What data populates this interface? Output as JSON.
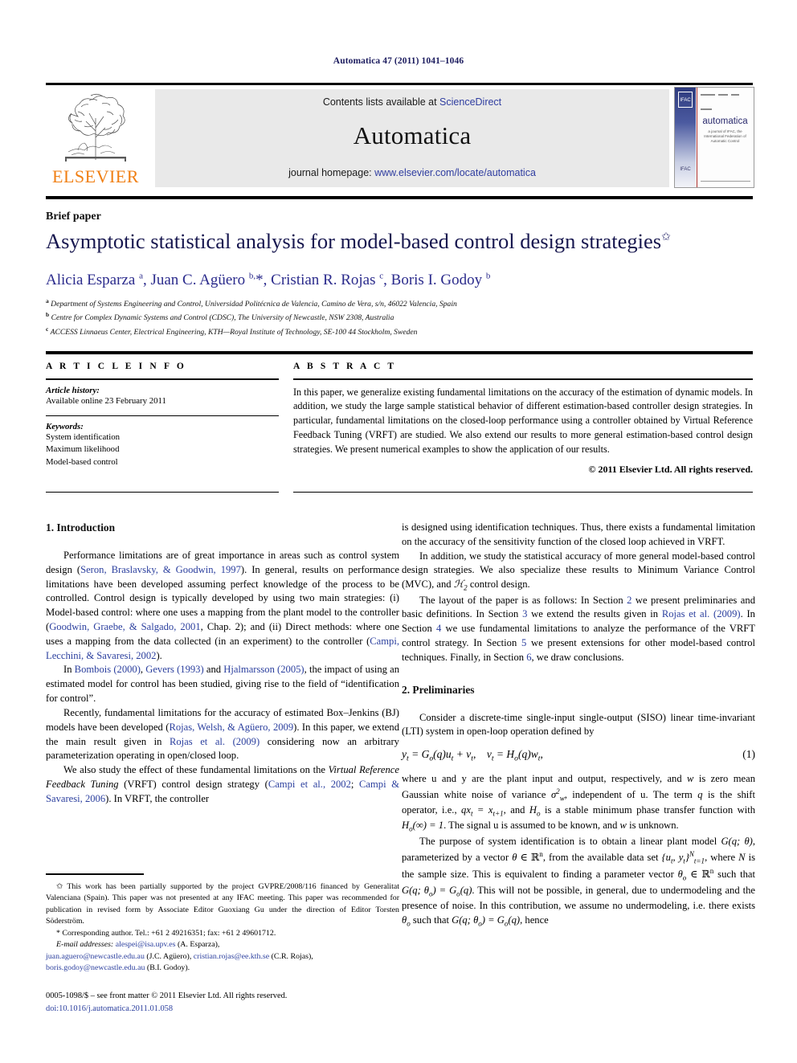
{
  "running_head": "Automatica 47 (2011) 1041–1046",
  "masthead": {
    "publisher_name": "ELSEVIER",
    "contents_prefix": "Contents lists available at ",
    "contents_link": "ScienceDirect",
    "journal_title": "Automatica",
    "homepage_prefix": "journal homepage: ",
    "homepage_link": "www.elsevier.com/locate/automatica",
    "cover": {
      "name": "automatica",
      "subtitle": "a journal of IFAC, the International Federation of Automatic Control",
      "badge": "IFAC"
    }
  },
  "article": {
    "type_label": "Brief paper",
    "title": "Asymptotic statistical analysis for model-based control design strategies",
    "title_footnote_marker": "✩",
    "authors_html": "Alicia Esparza <sup>a</sup>, Juan C. Agüero <sup>b,</sup>*, Cristian R. Rojas <sup>c</sup>, Boris I. Godoy <sup>b</sup>",
    "affiliations": [
      {
        "marker": "a",
        "text": "Department of Systems Engineering and Control, Universidad Politécnica de Valencia, Camino de Vera, s/n, 46022 Valencia, Spain"
      },
      {
        "marker": "b",
        "text": "Centre for Complex Dynamic Systems and Control (CDSC), The University of Newcastle, NSW 2308, Australia"
      },
      {
        "marker": "c",
        "text": "ACCESS Linnaeus Center, Electrical Engineering, KTH—Royal Institute of Technology, SE-100 44 Stockholm, Sweden"
      }
    ]
  },
  "article_info": {
    "heading": "A R T I C L E    I N F O",
    "history_label": "Article history:",
    "history_value": "Available online 23 February 2011",
    "keywords_label": "Keywords:",
    "keywords": [
      "System identification",
      "Maximum likelihood",
      "Model-based control"
    ]
  },
  "abstract": {
    "heading": "A B S T R A C T",
    "text": "In this paper, we generalize existing fundamental limitations on the accuracy of the estimation of dynamic models. In addition, we study the large sample statistical behavior of different estimation-based controller design strategies. In particular, fundamental limitations on the closed-loop performance using a controller obtained by Virtual Reference Feedback Tuning (VRFT) are studied. We also extend our results to more general estimation-based control design strategies. We present numerical examples to show the application of our results.",
    "copyright": "© 2011 Elsevier Ltd. All rights reserved."
  },
  "body": {
    "section1_heading": "1. Introduction",
    "section2_heading": "2. Preliminaries",
    "left_paragraphs": {
      "p1_a": "Performance limitations are of great importance in areas such as control system design (",
      "p1_cite1": "Seron, Braslavsky, & Goodwin, 1997",
      "p1_b": "). In general, results on performance limitations have been developed assuming perfect knowledge of the process to be controlled. Control design is typically developed by using two main strategies: (i) Model-based control: where one uses a mapping from the plant model to the controller (",
      "p1_cite2": "Goodwin, Graebe, & Salgado, 2001",
      "p1_c": ", Chap. 2); and (ii) Direct methods: where one uses a mapping from the data collected (in an experiment) to the controller (",
      "p1_cite3": "Campi, Lecchini, & Savaresi, 2002",
      "p1_d": ").",
      "p2_a": "In ",
      "p2_cite1": "Bombois (2000)",
      "p2_b": ", ",
      "p2_cite2": "Gevers (1993)",
      "p2_c": " and ",
      "p2_cite3": "Hjalmarsson (2005)",
      "p2_d": ", the impact of using an estimated model for control has been studied, giving rise to the field of “identification for control”.",
      "p3_a": "Recently, fundamental limitations for the accuracy of estimated Box–Jenkins (BJ) models have been developed (",
      "p3_cite1": "Rojas, Welsh, & Agüero, 2009",
      "p3_b": "). In this paper, we extend the main result given in ",
      "p3_cite2": "Rojas et al. (2009)",
      "p3_c": " considering now an arbitrary parameterization operating in open/closed loop.",
      "p4_a": "We also study the effect of these fundamental limitations on the ",
      "p4_ital": "Virtual Reference Feedback Tuning",
      "p4_b": " (VRFT) control design strategy (",
      "p4_cite1": "Campi et al., 2002",
      "p4_c": "; ",
      "p4_cite2": "Campi & Savaresi, 2006",
      "p4_d": "). In VRFT, the controller"
    },
    "right_paragraphs": {
      "p1": "is designed using identification techniques. Thus, there exists a fundamental limitation on the accuracy of the sensitivity function of the closed loop achieved in VRFT.",
      "p2_a": "In addition, we study the statistical accuracy of more general model-based control design strategies. We also specialize these results to Minimum Variance Control (MVC), and ",
      "p2_math": "ℋ₂",
      "p2_b": " control design.",
      "p3_a": "The layout of the paper is as follows: In Section ",
      "p3_n2": "2",
      "p3_b": " we present preliminaries and basic definitions. In Section ",
      "p3_n3": "3",
      "p3_c": " we extend the results given in ",
      "p3_cite": "Rojas et al. (2009)",
      "p3_d": ". In Section ",
      "p3_n4": "4",
      "p3_e": " we use fundamental limitations to analyze the performance of the VRFT control strategy. In Section ",
      "p3_n5": "5",
      "p3_f": " we present extensions for other model-based control techniques. Finally, in Section ",
      "p3_n6": "6",
      "p3_g": ", we draw conclusions.",
      "p4": "Consider a discrete-time single-input single-output (SISO) linear time-invariant (LTI) system in open-loop operation defined by",
      "equation1": "y_t = G_o(q)u_t + v_t,    v_t = H_o(q)w_t,",
      "equation1_number": "(1)",
      "p5_a": "where u and y are the plant input and output, respectively, and ",
      "p5_w": "w",
      "p5_b": " is zero mean Gaussian white noise of variance σ²_w, independent of u. The term q is the shift operator, i.e., qx_t = x_{t+1}, and H_o is a stable minimum phase transfer function with H_o(∞) = 1. The signal u is assumed to be known, and w is unknown.",
      "p6": "The purpose of system identification is to obtain a linear plant model G(q; θ), parameterized by a vector θ ∈ ℝⁿ, from the available data set {u_t, y_t}ᴺ_{t=1}, where N is the sample size. This is equivalent to finding a parameter vector θ_o ∈ ℝⁿ such that G(q; θ_o) = G_o(q). This will not be possible, in general, due to undermodeling and the presence of noise. In this contribution, we assume no undermodeling, i.e. there exists θ_o such that G(q; θ_o) = G_o(q), hence"
    }
  },
  "footnote": {
    "star_marker": "✩",
    "funding": "This work has been partially supported by the project GVPRE/2008/116 financed by Generalitat Valenciana (Spain). This paper was not presented at any IFAC meeting. This paper was recommended for publication in revised form by Associate Editor Guoxiang Gu under the direction of Editor Torsten Söderström.",
    "corresponding_marker": "*",
    "corresponding": "Corresponding author. Tel.: +61 2 49216351; fax: +61 2 49601712.",
    "email_label": "E-mail addresses:",
    "emails": [
      {
        "address": "alespei@isa.upv.es",
        "owner": " (A. Esparza),"
      },
      {
        "address": "juan.aguero@newcastle.edu.au",
        "owner": " (J.C. Agüero),"
      },
      {
        "address": "cristian.rojas@ee.kth.se",
        "owner": " (C.R. Rojas),"
      },
      {
        "address": "boris.godoy@newcastle.edu.au",
        "owner": " (B.I. Godoy)."
      }
    ]
  },
  "imprint": {
    "line1": "0005-1098/$ – see front matter © 2011 Elsevier Ltd. All rights reserved.",
    "doi": "doi:10.1016/j.automatica.2011.01.058"
  },
  "colors": {
    "link_blue": "#2f3da0",
    "citation_blue": "#2b3f9e",
    "title_navy": "#17174f",
    "author_blue": "#2b2b8c",
    "elsevier_orange": "#F07F13",
    "band_grey": "#e9e9e9"
  }
}
